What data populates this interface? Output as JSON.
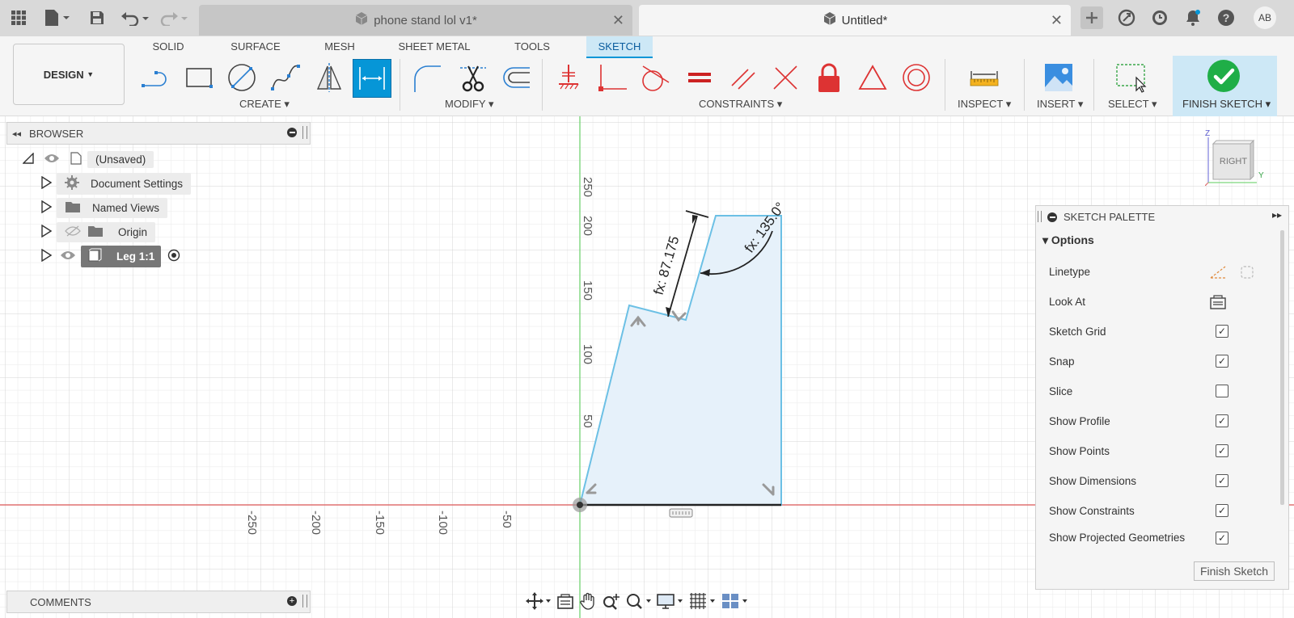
{
  "titlebar": {
    "tabs": [
      {
        "label": "phone stand lol v1*",
        "active": false
      },
      {
        "label": "Untitled*",
        "active": true
      }
    ],
    "user_initials": "AB"
  },
  "toolbar": {
    "workspace": "DESIGN",
    "tabs": [
      "SOLID",
      "SURFACE",
      "MESH",
      "SHEET METAL",
      "TOOLS",
      "SKETCH"
    ],
    "active_tab": "SKETCH",
    "groups": {
      "create": "CREATE",
      "modify": "MODIFY",
      "constraints": "CONSTRAINTS",
      "inspect": "INSPECT",
      "insert": "INSERT",
      "select": "SELECT",
      "finish": "FINISH SKETCH"
    }
  },
  "browser": {
    "title": "BROWSER",
    "root": "(Unsaved)",
    "items": [
      {
        "label": "Document Settings",
        "icon": "gear-icon"
      },
      {
        "label": "Named Views",
        "icon": "folder-icon"
      },
      {
        "label": "Origin",
        "icon": "folder-icon"
      },
      {
        "label": "Leg 1:1",
        "icon": "component-icon"
      }
    ]
  },
  "comments": {
    "title": "COMMENTS"
  },
  "sketch": {
    "dimension_length": "fx: 87.175",
    "dimension_angle": "fx: 135.0°",
    "axis_y_ticks": [
      "250",
      "200",
      "150",
      "100",
      "50"
    ],
    "axis_x_ticks": [
      "-250",
      "-200",
      "-150",
      "-100",
      "-50"
    ]
  },
  "viewcube": {
    "face": "RIGHT",
    "axis_z": "Z",
    "axis_y": "Y"
  },
  "palette": {
    "title": "SKETCH PALETTE",
    "section": "Options",
    "rows": [
      {
        "label": "Linetype",
        "kind": "icons"
      },
      {
        "label": "Look At",
        "kind": "icon"
      },
      {
        "label": "Sketch Grid",
        "kind": "checkbox",
        "checked": true
      },
      {
        "label": "Snap",
        "kind": "checkbox",
        "checked": true
      },
      {
        "label": "Slice",
        "kind": "checkbox",
        "checked": false
      },
      {
        "label": "Show Profile",
        "kind": "checkbox",
        "checked": true
      },
      {
        "label": "Show Points",
        "kind": "checkbox",
        "checked": true
      },
      {
        "label": "Show Dimensions",
        "kind": "checkbox",
        "checked": true
      },
      {
        "label": "Show Constraints",
        "kind": "checkbox",
        "checked": true
      },
      {
        "label": "Show Projected Geometries",
        "kind": "checkbox",
        "checked": true
      }
    ],
    "finish_button": "Finish Sketch"
  },
  "colors": {
    "accent": "#0696d7",
    "profile_fill": "#e6f1fa",
    "profile_stroke": "#6cc0e5",
    "x_axis": "#e07070",
    "y_axis": "#7cd67c",
    "finish_green": "#1fae47"
  }
}
